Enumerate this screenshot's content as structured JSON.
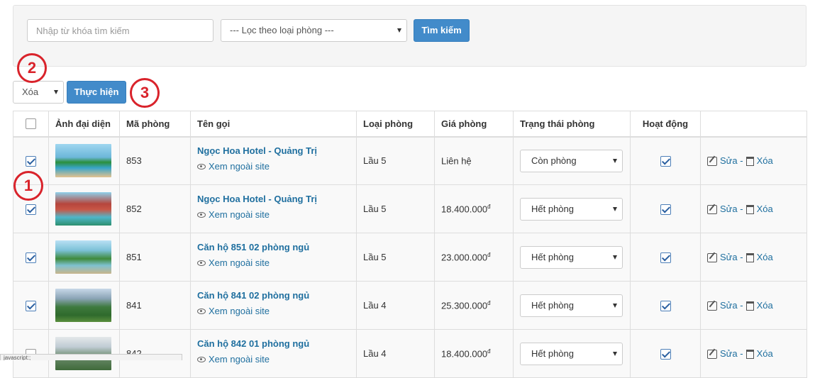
{
  "filter": {
    "search_placeholder": "Nhập từ khóa tìm kiếm",
    "room_type_filter": "--- Lọc theo loại phòng ---",
    "search_button": "Tìm kiếm"
  },
  "bulk": {
    "action_value": "Xóa",
    "execute_button": "Thực hiện"
  },
  "markers": [
    "1",
    "2",
    "3"
  ],
  "table": {
    "headers": [
      "Ảnh đại diện",
      "Mã phòng",
      "Tên gọi",
      "Loại phòng",
      "Giá phòng",
      "Trạng thái phòng",
      "Hoạt động"
    ],
    "rows": [
      {
        "checked": true,
        "code": "853",
        "name": "Ngọc Hoa Hotel - Quảng Trị",
        "link": "Xem ngoài site",
        "type": "Lầu 5",
        "price": "Liên hệ",
        "currency": "",
        "status": "Còn phòng",
        "active": true
      },
      {
        "checked": true,
        "code": "852",
        "name": "Ngọc Hoa Hotel - Quảng Trị",
        "link": "Xem ngoài site",
        "type": "Lầu 5",
        "price": "18.400.000",
        "currency": "đ",
        "status": "Hết phòng",
        "active": true
      },
      {
        "checked": true,
        "code": "851",
        "name": "Căn hộ 851 02 phòng ngủ",
        "link": "Xem ngoài site",
        "type": "Lầu 5",
        "price": "23.000.000",
        "currency": "đ",
        "status": "Hết phòng",
        "active": true
      },
      {
        "checked": true,
        "code": "841",
        "name": "Căn hộ 841 02 phòng ngủ",
        "link": "Xem ngoài site",
        "type": "Lầu 4",
        "price": "25.300.000",
        "currency": "đ",
        "status": "Hết phòng",
        "active": true
      },
      {
        "checked": false,
        "code": "842",
        "name": "Căn hộ 842 01 phòng ngủ",
        "link": "Xem ngoài site",
        "type": "Lầu 4",
        "price": "18.400.000",
        "currency": "đ",
        "status": "Hết phòng",
        "active": true
      }
    ],
    "edit_label": "Sửa",
    "delete_label": "Xóa",
    "separator": "-"
  },
  "status_bar": "javascript:;"
}
